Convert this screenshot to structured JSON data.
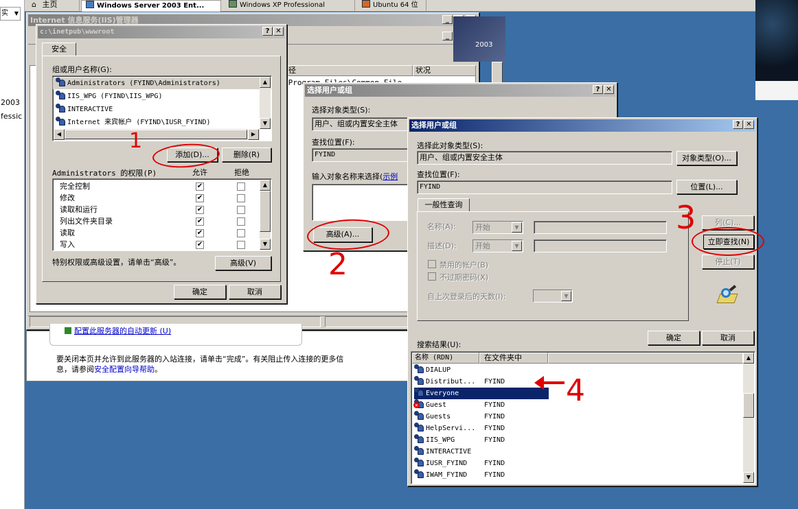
{
  "browser_tabs": [
    "主页",
    "Windows Server 2003 Ent...",
    "Windows XP Professional",
    "Ubuntu 64 位"
  ],
  "left_strip": {
    "combo_text": "实",
    "line1": "2003",
    "line2": "fessic"
  },
  "iis_window": {
    "title": "Internet 信息服务(IIS)管理器",
    "col_path_header": "径",
    "col_status_header": "状况",
    "path_value": "\\Program Files\\Common File",
    "desktop_label": "2003"
  },
  "bottom_panel": {
    "link_text": "配置此服务器的自动更新 (U)",
    "text_line1": "要关闭本页并允许到此服务器的入站连接，请单击“完成”。有关阻止传入连接的更多信",
    "text_line2_prefix": "息，请参阅",
    "text_link": "安全配置向导帮助",
    "text_suffix": "。"
  },
  "props_dialog": {
    "title": "c:\\inetpub\\wwwroot",
    "tab_security": "安全",
    "group_label": "组或用户名称(G):",
    "users": [
      "Administrators (FYIND\\Administrators)",
      "IIS_WPG (FYIND\\IIS_WPG)",
      "INTERACTIVE",
      "Internet 来宾帐户 (FYIND\\IUSR_FYIND)"
    ],
    "add_button": "添加(D)...",
    "remove_button": "删除(R)",
    "perm_label": "Administrators 的权限(P)",
    "allow_header": "允许",
    "deny_header": "拒绝",
    "permissions": [
      {
        "name": "完全控制",
        "allow": "✔",
        "deny": ""
      },
      {
        "name": "修改",
        "allow": "✔",
        "deny": ""
      },
      {
        "name": "读取和运行",
        "allow": "✔",
        "deny": ""
      },
      {
        "name": "列出文件夹目录",
        "allow": "✔",
        "deny": ""
      },
      {
        "name": "读取",
        "allow": "✔",
        "deny": ""
      },
      {
        "name": "写入",
        "allow": "✔",
        "deny": ""
      }
    ],
    "special_text": "特别权限或高级设置，请单击“高级”。",
    "advanced_button": "高级(V)",
    "ok_button": "确定",
    "cancel_button": "取消"
  },
  "select_dialog_1": {
    "title": "选择用户或组",
    "obj_type_label": "选择对象类型(S):",
    "obj_type_value": "用户、组或内置安全主体",
    "location_label": "查找位置(F):",
    "location_value": "FYIND",
    "enter_label": "输入对象名称来选择(",
    "example_link": "示例",
    "advanced_button": "高级(A)..."
  },
  "select_dialog_2": {
    "title": "选择用户或组",
    "obj_type_label": "选择此对象类型(S):",
    "obj_type_value": "用户、组或内置安全主体",
    "obj_type_button": "对象类型(O)...",
    "location_label": "查找位置(F):",
    "location_value": "FYIND",
    "location_button": "位置(L)...",
    "tab_general": "一般性查询",
    "name_label": "名称(A):",
    "desc_label": "描述(D):",
    "starts_with": "开始",
    "disabled_accounts": "禁用的帐户(B)",
    "non_expiring": "不过期密码(X)",
    "days_label": "自上次登录后的天数(I):",
    "columns_button": "列(C)...",
    "find_now_button": "立即查找(N)",
    "stop_button": "停止(T)",
    "ok_button": "确定",
    "cancel_button": "取消",
    "results_label": "搜索结果(U):",
    "col_name": "名称 (RDN)",
    "col_folder": "在文件夹中",
    "results": [
      {
        "name": "DIALUP",
        "folder": ""
      },
      {
        "name": "Distribut...",
        "folder": "FYIND"
      },
      {
        "name": "Everyone",
        "folder": ""
      },
      {
        "name": "Guest",
        "folder": "FYIND"
      },
      {
        "name": "Guests",
        "folder": "FYIND"
      },
      {
        "name": "HelpServi...",
        "folder": "FYIND"
      },
      {
        "name": "IIS_WPG",
        "folder": "FYIND"
      },
      {
        "name": "INTERACTIVE",
        "folder": ""
      },
      {
        "name": "IUSR_FYIND",
        "folder": "FYIND"
      },
      {
        "name": "IWAM_FYIND",
        "folder": "FYIND"
      }
    ]
  },
  "annotations": [
    "1",
    "2",
    "3",
    "4"
  ],
  "colors": {
    "desktop": "#3a6ea5",
    "titlebar": "#0a246a",
    "annotation": "#e00000",
    "face": "#d4d0c8"
  }
}
